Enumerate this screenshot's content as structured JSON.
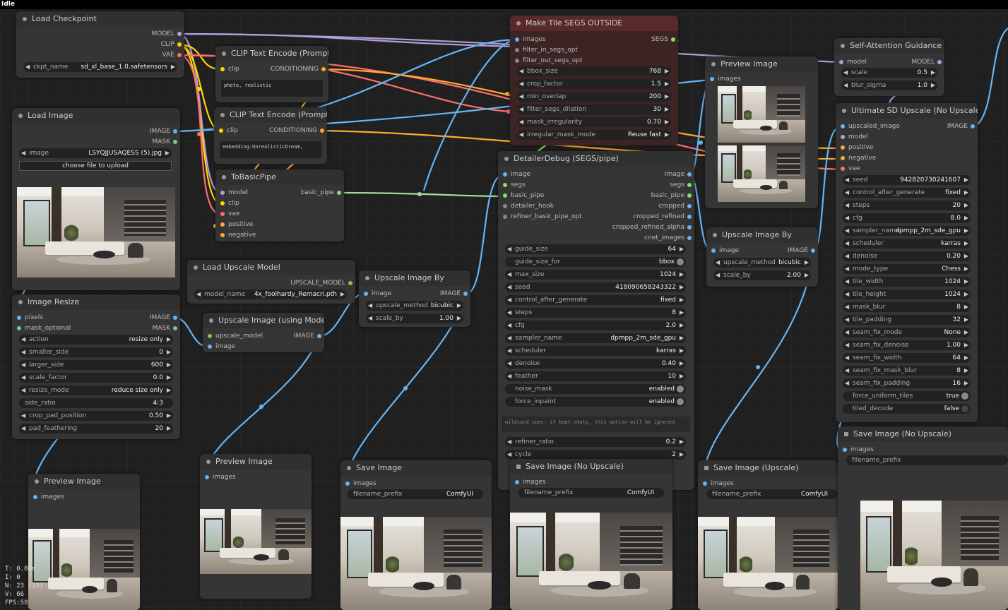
{
  "status": "Idle",
  "colors": {
    "model": "#b39ddb",
    "clip": "#ffd500",
    "vae": "#ff6e6e",
    "conditioning": "#ffa931",
    "image": "#64b5f6",
    "mask": "#81c784",
    "segs": "#7ee26a",
    "pipe": "#a6d8a0",
    "upscale_model": "#8bc34a"
  },
  "stats": [
    "T: 0.00s",
    "I: 0",
    "N: 23 [23]",
    "V: 66",
    "FPS:58"
  ],
  "load_checkpoint": {
    "title": "Load Checkpoint",
    "out_model": "MODEL",
    "out_clip": "CLIP",
    "out_vae": "VAE",
    "ckpt_label": "ckpt_name",
    "ckpt_value": "sd_xl_base_1.0.safetensors"
  },
  "clip1": {
    "title": "CLIP Text Encode (Prompt)",
    "in_clip": "clip",
    "out": "CONDITIONING",
    "text": "photo, realistic"
  },
  "clip2": {
    "title": "CLIP Text Encode (Prompt)",
    "in_clip": "clip",
    "out": "CONDITIONING",
    "text": "embedding:UnrealisticDream,"
  },
  "load_image": {
    "title": "Load Image",
    "out_image": "IMAGE",
    "out_mask": "MASK",
    "image_label": "image",
    "image_value": "LSYQJJUSAQESS (5).jpg",
    "upload": "choose file to upload"
  },
  "to_basic_pipe": {
    "title": "ToBasicPipe",
    "inputs": [
      "model",
      "clip",
      "vae",
      "positive",
      "negative"
    ],
    "out": "basic_pipe"
  },
  "load_upscale": {
    "title": "Load Upscale Model",
    "out": "UPSCALE_MODEL",
    "label": "model_name",
    "value": "4x_foolhardy_Remacri.pth"
  },
  "image_resize": {
    "title": "Image Resize",
    "in_pixels": "pixels",
    "in_mask": "mask_optional",
    "out_image": "IMAGE",
    "out_mask": "MASK",
    "widgets": [
      {
        "l": "action",
        "v": "resize only"
      },
      {
        "l": "smaller_side",
        "v": "0"
      },
      {
        "l": "larger_side",
        "v": "600"
      },
      {
        "l": "scale_factor",
        "v": "0.0"
      },
      {
        "l": "resize_mode",
        "v": "reduce size only"
      },
      {
        "l": "side_ratio",
        "v": "4:3"
      },
      {
        "l": "crop_pad_position",
        "v": "0.50"
      },
      {
        "l": "pad_feathering",
        "v": "20"
      }
    ]
  },
  "upscale_with_model": {
    "title": "Upscale Image (using Model)",
    "in1": "upscale_model",
    "in2": "image",
    "out": "IMAGE"
  },
  "upscale_by1": {
    "title": "Upscale Image By",
    "in": "image",
    "out": "IMAGE",
    "method_label": "upscale_method",
    "method_value": "bicubic",
    "scale_label": "scale_by",
    "scale_value": "1.00"
  },
  "make_tile": {
    "title": "Make Tile SEGS OUTSIDE",
    "inputs": [
      "images",
      "filter_in_segs_opt",
      "filter_out_segs_opt"
    ],
    "out": "SEGS",
    "widgets": [
      {
        "l": "bbox_size",
        "v": "768"
      },
      {
        "l": "crop_factor",
        "v": "1.5"
      },
      {
        "l": "min_overlap",
        "v": "200"
      },
      {
        "l": "filter_segs_dilation",
        "v": "30"
      },
      {
        "l": "mask_irregularity",
        "v": "0.70"
      },
      {
        "l": "irregular_mask_mode",
        "v": "Reuse fast"
      }
    ]
  },
  "detailer": {
    "title": "DetailerDebug (SEGS/pipe)",
    "inputs": [
      "image",
      "segs",
      "basic_pipe",
      "detailer_hook",
      "refiner_basic_pipe_opt"
    ],
    "outputs": [
      "image",
      "segs",
      "basic_pipe",
      "cropped",
      "cropped_refined",
      "cropped_refined_alpha",
      "cnet_images"
    ],
    "widgets": [
      {
        "l": "guide_size",
        "v": "64",
        "t": "n"
      },
      {
        "l": "guide_size_for",
        "v": "bbox",
        "t": "t"
      },
      {
        "l": "max_size",
        "v": "1024",
        "t": "n"
      },
      {
        "l": "seed",
        "v": "418090658243322",
        "t": "n"
      },
      {
        "l": "control_after_generate",
        "v": "fixed",
        "t": "n"
      },
      {
        "l": "steps",
        "v": "8",
        "t": "n"
      },
      {
        "l": "cfg",
        "v": "2.0",
        "t": "n"
      },
      {
        "l": "sampler_name",
        "v": "dpmpp_2m_sde_gpu",
        "t": "n"
      },
      {
        "l": "scheduler",
        "v": "karras",
        "t": "n"
      },
      {
        "l": "denoise",
        "v": "0.40",
        "t": "n"
      },
      {
        "l": "feather",
        "v": "10",
        "t": "n"
      },
      {
        "l": "noise_mask",
        "v": "enabled",
        "t": "t"
      },
      {
        "l": "force_inpaint",
        "v": "enabled",
        "t": "t"
      }
    ],
    "wildcard": "wildcard spec: if kept empty, this option will be ignored",
    "widgets2": [
      {
        "l": "refiner_ratio",
        "v": "0.2"
      },
      {
        "l": "cycle",
        "v": "2"
      }
    ]
  },
  "preview_top": {
    "title": "Preview Image",
    "in": "images"
  },
  "sag": {
    "title": "Self-Attention Guidance",
    "in": "model",
    "out": "MODEL",
    "widgets": [
      {
        "l": "scale",
        "v": "0.5"
      },
      {
        "l": "blur_sigma",
        "v": "1.0"
      }
    ]
  },
  "usdu": {
    "title": "Ultimate SD Upscale (No Upscale)",
    "inputs": [
      "upscaled_image",
      "model",
      "positive",
      "negative",
      "vae"
    ],
    "out": "IMAGE",
    "widgets": [
      {
        "l": "seed",
        "v": "942820730241607",
        "t": "n"
      },
      {
        "l": "control_after_generate",
        "v": "fixed",
        "t": "n"
      },
      {
        "l": "steps",
        "v": "20",
        "t": "n"
      },
      {
        "l": "cfg",
        "v": "8.0",
        "t": "n"
      },
      {
        "l": "sampler_name",
        "v": "dpmpp_2m_sde_gpu",
        "t": "n"
      },
      {
        "l": "scheduler",
        "v": "karras",
        "t": "n"
      },
      {
        "l": "denoise",
        "v": "0.20",
        "t": "n"
      },
      {
        "l": "mode_type",
        "v": "Chess",
        "t": "n"
      },
      {
        "l": "tile_width",
        "v": "1024",
        "t": "n"
      },
      {
        "l": "tile_height",
        "v": "1024",
        "t": "n"
      },
      {
        "l": "mask_blur",
        "v": "8",
        "t": "n"
      },
      {
        "l": "tile_padding",
        "v": "32",
        "t": "n"
      },
      {
        "l": "seam_fix_mode",
        "v": "None",
        "t": "n"
      },
      {
        "l": "seam_fix_denoise",
        "v": "1.00",
        "t": "n"
      },
      {
        "l": "seam_fix_width",
        "v": "64",
        "t": "n"
      },
      {
        "l": "seam_fix_mask_blur",
        "v": "8",
        "t": "n"
      },
      {
        "l": "seam_fix_padding",
        "v": "16",
        "t": "n"
      },
      {
        "l": "force_uniform_tiles",
        "v": "true",
        "t": "t"
      },
      {
        "l": "tiled_decode",
        "v": "false",
        "t": "f"
      }
    ]
  },
  "upscale_by2": {
    "title": "Upscale Image By",
    "in": "image",
    "out": "IMAGE",
    "method_label": "upscale_method",
    "method_value": "bicubic",
    "scale_label": "scale_by",
    "scale_value": "2.00"
  },
  "preview_left": {
    "title": "Preview Image",
    "in": "images"
  },
  "preview_mid": {
    "title": "Preview Image",
    "in": "images"
  },
  "save_image": {
    "title": "Save Image",
    "in": "images",
    "label": "filename_prefix",
    "value": "ComfyUI"
  },
  "save_noup1": {
    "title": "Save Image (No Upscale)",
    "in": "images",
    "label": "filename_prefix",
    "value": "ComfyUI"
  },
  "save_up": {
    "title": "Save Image (Upscale)",
    "in": "images",
    "label": "filename_prefix",
    "value": "ComfyUI"
  },
  "save_noup2": {
    "title": "Save Image (No Upscale)",
    "in": "images",
    "label": "filename_prefix",
    "value": ""
  }
}
